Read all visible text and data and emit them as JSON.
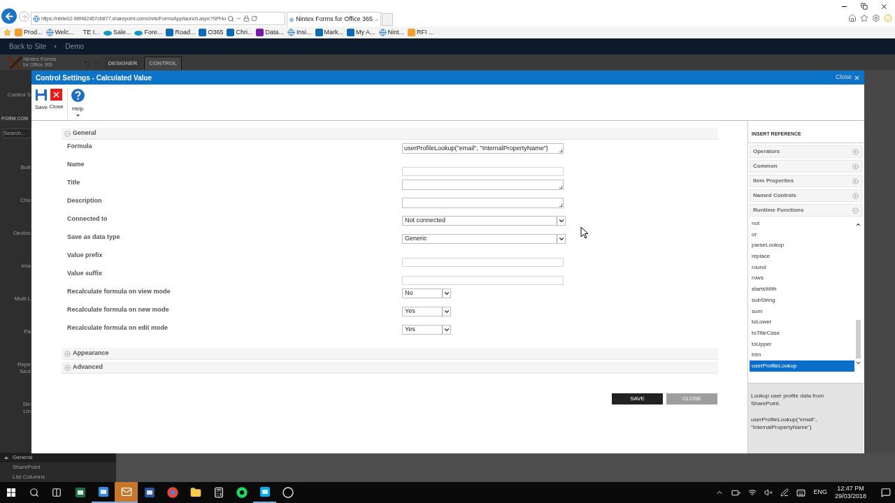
{
  "browser": {
    "url": "https://ntxte02-96f462457cb877.sharepoint.com/chris/FormsApp/launch.aspx?SPHo",
    "tab_title": "Nintex Forms for Office 365",
    "bookmarks": [
      {
        "kind": "folder",
        "label": "Prod..."
      },
      {
        "kind": "page",
        "label": "Welc..."
      },
      {
        "kind": "blank",
        "label": "TE I..."
      },
      {
        "kind": "cloud",
        "label": "Sale..."
      },
      {
        "kind": "cloud",
        "label": "Fore..."
      },
      {
        "kind": "sharepoint",
        "label": "Road..."
      },
      {
        "kind": "sharepoint",
        "label": "O365"
      },
      {
        "kind": "sharepoint",
        "label": "Chri..."
      },
      {
        "kind": "onenote",
        "label": "Data..."
      },
      {
        "kind": "page",
        "label": "Insi..."
      },
      {
        "kind": "sharepoint",
        "label": "Mark..."
      },
      {
        "kind": "sharepoint",
        "label": "My A..."
      },
      {
        "kind": "page",
        "label": "Nint..."
      },
      {
        "kind": "folder",
        "label": "RFI ..."
      }
    ]
  },
  "site": {
    "breadcrumbs": [
      "Back to Site",
      "Demo"
    ],
    "logo_title": "Nintex Forms",
    "logo_subtitle": "for Office 365",
    "tabs": [
      {
        "label": "DESIGNER",
        "selected": false
      },
      {
        "label": "CONTROL",
        "selected": true
      }
    ],
    "ribbon_label": "Control S",
    "panel_title": "FORM CON",
    "search_placeholder": "Search...",
    "controls": [
      "Butt",
      "Cho",
      "Geoloc",
      "Ima",
      "Multi L",
      "Pa",
      "Repe\nSect",
      "Sin\nLin"
    ],
    "categories": [
      {
        "label": "General",
        "expanded": true
      },
      {
        "label": "SharePoint",
        "expanded": false
      },
      {
        "label": "List Columns",
        "expanded": false
      }
    ]
  },
  "dialog": {
    "title": "Control Settings - Calculated Value",
    "close_label": "Close",
    "toolbar": [
      {
        "kind": "save",
        "label": "Save"
      },
      {
        "kind": "close",
        "label": "Close"
      },
      {
        "kind": "help",
        "label": "Help"
      }
    ],
    "sections": [
      {
        "title": "General",
        "expanded": true,
        "fields": [
          {
            "label": "Formula",
            "kind": "textarea",
            "value": "userProfileLookup(\"email\", \"InternalPropertyName\")"
          },
          {
            "label": "Name",
            "kind": "text"
          },
          {
            "label": "Title",
            "kind": "textarea"
          },
          {
            "label": "Description",
            "kind": "textarea"
          },
          {
            "label": "Connected to",
            "kind": "select",
            "value": "Not connected"
          },
          {
            "label": "Save as data type",
            "kind": "select",
            "value": "Generic"
          },
          {
            "label": "Value prefix",
            "kind": "text"
          },
          {
            "label": "Value suffix",
            "kind": "text"
          },
          {
            "label": "Recalculate formula on view mode",
            "kind": "small_select",
            "value": "No"
          },
          {
            "label": "Recalculate formula on new mode",
            "kind": "small_select",
            "value": "Yes"
          },
          {
            "label": "Recalculate formula on edit mode",
            "kind": "small_select",
            "value": "Yes"
          }
        ]
      },
      {
        "title": "Appearance",
        "expanded": false
      },
      {
        "title": "Advanced",
        "expanded": false
      }
    ],
    "buttons": [
      {
        "label": "SAVE",
        "disabled": false
      },
      {
        "label": "CLOSE",
        "disabled": true
      }
    ],
    "reference": {
      "title": "INSERT REFERENCE",
      "groups": [
        {
          "title": "Operators",
          "expanded": false
        },
        {
          "title": "Common",
          "expanded": false
        },
        {
          "title": "Item Properties",
          "expanded": false
        },
        {
          "title": "Named Controls",
          "expanded": false
        },
        {
          "title": "Runtime Functions",
          "expanded": true
        }
      ],
      "functions": [
        {
          "label": "not",
          "selected": false
        },
        {
          "label": "or",
          "selected": false
        },
        {
          "label": "parseLookup",
          "selected": false
        },
        {
          "label": "replace",
          "selected": false
        },
        {
          "label": "round",
          "selected": false
        },
        {
          "label": "rows",
          "selected": false
        },
        {
          "label": "startsWith",
          "selected": false
        },
        {
          "label": "subString",
          "selected": false
        },
        {
          "label": "sum",
          "selected": false
        },
        {
          "label": "toLower",
          "selected": false
        },
        {
          "label": "toTitleCase",
          "selected": false
        },
        {
          "label": "toUpper",
          "selected": false
        },
        {
          "label": "trim",
          "selected": false
        },
        {
          "label": "userProfileLookup",
          "selected": true
        }
      ],
      "description": "Lookup user profile data from SharePoint.",
      "syntax": "userProfileLookup(\"email\", \"InternalPropertyName\")"
    }
  },
  "taskbar": {
    "apps": [
      {
        "kind": "excel",
        "active": false
      },
      {
        "kind": "ie",
        "active": true
      },
      {
        "kind": "outlook",
        "active": true
      },
      {
        "kind": "word",
        "active": false
      },
      {
        "kind": "chrome",
        "active": false
      },
      {
        "kind": "explorer",
        "active": false
      },
      {
        "kind": "calculator",
        "active": false
      },
      {
        "kind": "spotify",
        "active": false
      },
      {
        "kind": "skype",
        "active": true
      },
      {
        "kind": "clock",
        "active": false
      }
    ],
    "language": "ENG",
    "time": "12:47 PM",
    "date": "29/03/2018"
  }
}
